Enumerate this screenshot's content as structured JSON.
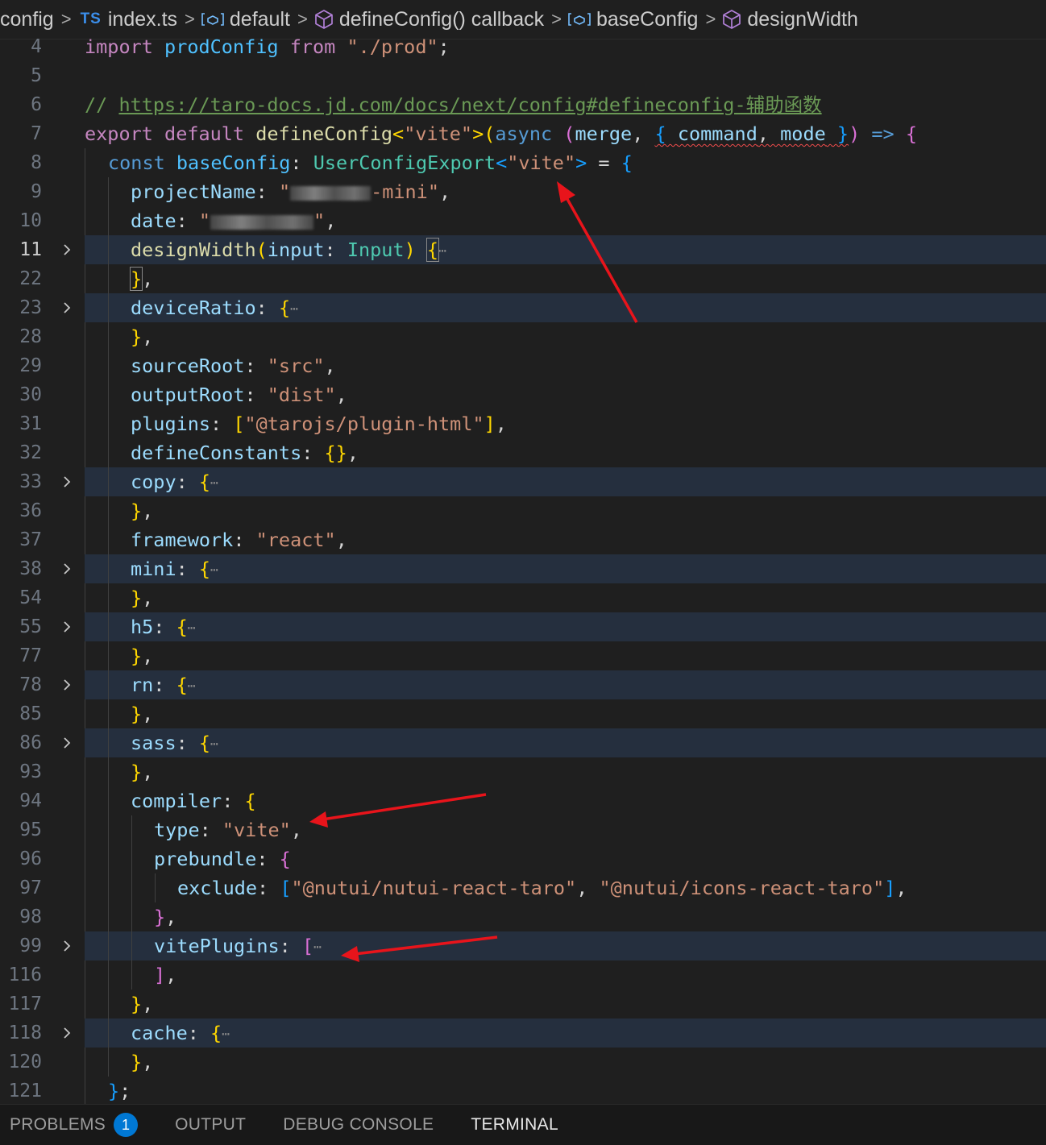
{
  "breadcrumb": {
    "items": [
      {
        "label": "config",
        "icon": ""
      },
      {
        "label": "index.ts",
        "icon": "ts-file-icon",
        "icon_text": "TS"
      },
      {
        "label": "default",
        "icon": "variable-icon"
      },
      {
        "label": "defineConfig() callback",
        "icon": "method-cube-icon"
      },
      {
        "label": "baseConfig",
        "icon": "variable-icon"
      },
      {
        "label": "designWidth",
        "icon": "method-cube-icon"
      }
    ],
    "separator": ">"
  },
  "editor": {
    "line_numbers": [
      "4",
      "5",
      "6",
      "7",
      "8",
      "9",
      "10",
      "11",
      "22",
      "23",
      "28",
      "29",
      "30",
      "31",
      "32",
      "33",
      "36",
      "37",
      "38",
      "54",
      "55",
      "77",
      "78",
      "85",
      "86",
      "93",
      "94",
      "95",
      "96",
      "97",
      "98",
      "99",
      "116",
      "117",
      "118",
      "120",
      "121"
    ],
    "active_line": "11",
    "text": {
      "l4_import": "import",
      "l4_name": "prodConfig",
      "l4_from": "from",
      "l4_path": "\"./prod\"",
      "l4_semi": ";",
      "l6_comment": "// ",
      "l6_url": "https://taro-docs.jd.com/docs/next/config#defineconfig-辅助函数",
      "l7_export": "export",
      "l7_default": "default",
      "l7_fn": "defineConfig",
      "l7_lt": "<",
      "l7_vite": "\"vite\"",
      "l7_gt": ">",
      "l7_paren": "(",
      "l7_async": "async",
      "l7_p2": "(",
      "l7_merge": "merge",
      "l7_comma": ", ",
      "l7_ob": "{",
      "l7_command": "command",
      "l7_c2": ", ",
      "l7_mode": "mode",
      "l7_cb": "}",
      "l7_p3": ")",
      "l7_arrow": "=>",
      "l7_brace": "{",
      "l8_const": "const",
      "l8_name": "baseConfig",
      "l8_colon": ": ",
      "l8_type": "UserConfigExport",
      "l8_lt": "<",
      "l8_vite": "\"vite\"",
      "l8_gt": ">",
      "l8_eq": " = ",
      "l8_brace": "{",
      "l9_key": "projectName",
      "l9_colon": ": ",
      "l9_q": "\"",
      "l9_val": "-mini\"",
      "l9_comma": ",",
      "l10_key": "date",
      "l10_colon": ": ",
      "l10_q": "\"",
      "l10_val": "\"",
      "l10_comma": ",",
      "l11_key": "designWidth",
      "l11_p1": "(",
      "l11_arg": "input",
      "l11_colon": ": ",
      "l11_type": "Input",
      "l11_p2": ")",
      "l11_brace": "{",
      "l11_dots": "⋯",
      "close_brace": "}",
      "close_comma": ",",
      "l23_key": "deviceRatio",
      "colon": ": ",
      "open_brace": "{",
      "dots": "⋯",
      "l29_key": "sourceRoot",
      "l29_val": "\"src\"",
      "l30_key": "outputRoot",
      "l30_val": "\"dist\"",
      "l31_key": "plugins",
      "l31_ob": "[",
      "l31_val": "\"@tarojs/plugin-html\"",
      "l31_cb": "]",
      "l32_key": "defineConstants",
      "l32_val": "{}",
      "l33_key": "copy",
      "l37_key": "framework",
      "l37_val": "\"react\"",
      "l38_key": "mini",
      "l55_key": "h5",
      "l78_key": "rn",
      "l86_key": "sass",
      "l94_key": "compiler",
      "l95_key": "type",
      "l95_val": "\"vite\"",
      "l96_key": "prebundle",
      "l97_key": "exclude",
      "l97_ob": "[",
      "l97_v1": "\"@nutui/nutui-react-taro\"",
      "l97_sep": ", ",
      "l97_v2": "\"@nutui/icons-react-taro\"",
      "l97_cb": "]",
      "l99_key": "vitePlugins",
      "l99_ob": "[",
      "l116_cb": "]",
      "l118_key": "cache",
      "l121_end": "}",
      "l121_semi": ";"
    }
  },
  "panel": {
    "tabs": [
      {
        "label": "PROBLEMS",
        "badge": "1"
      },
      {
        "label": "OUTPUT"
      },
      {
        "label": "DEBUG CONSOLE"
      },
      {
        "label": "TERMINAL",
        "active": true
      }
    ]
  },
  "colors": {
    "background": "#1f1f1f",
    "fold_highlight": "#252f3e",
    "annotation_arrow": "#e8141b",
    "badge": "#0078d4"
  }
}
